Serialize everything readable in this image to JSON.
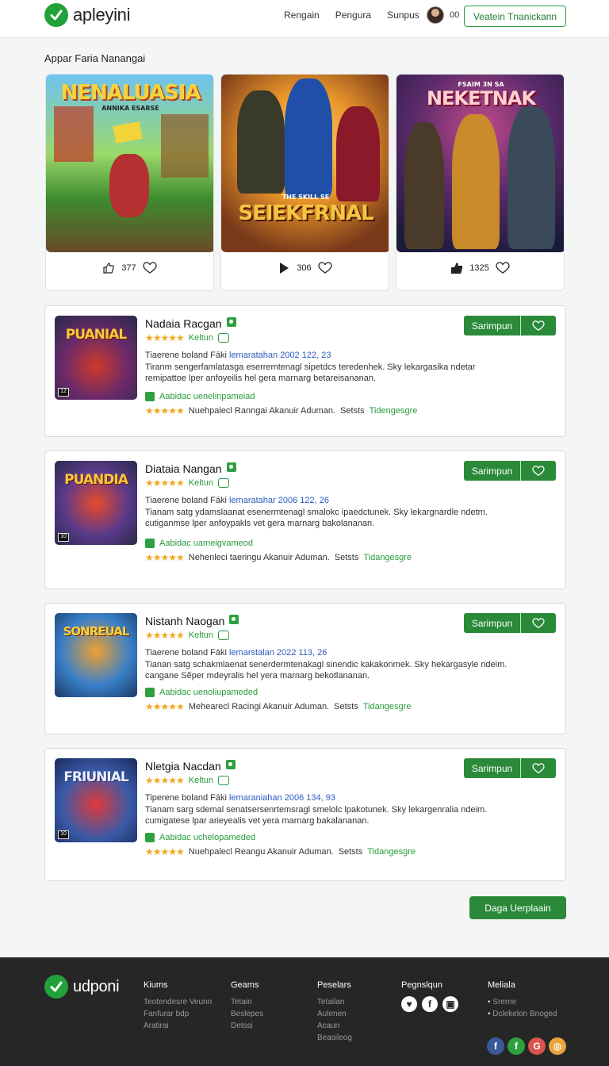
{
  "header": {
    "brand": "apleyini",
    "nav": [
      "Rengain",
      "Pengura",
      "Sunpus"
    ],
    "avatar_count": "00",
    "cta_label": "Veatein Tnanickann"
  },
  "section_title": "Appar Faria Nanangai",
  "featured": [
    {
      "title": "NENALUASIA",
      "subtitle": "ANNIKA ESARSE",
      "count": "377",
      "stat_icon": "thumbs-up-icon"
    },
    {
      "title": "SEIEKFRNAL",
      "subtitle": "THE SKILL SE",
      "count": "306",
      "stat_icon": "play-icon"
    },
    {
      "title": "NEKETNAK",
      "subtitle": "FSAIM 3N SA",
      "count": "1325",
      "stat_icon": "thumbs-up-icon"
    }
  ],
  "games": [
    {
      "thumb_title": "PUANIAL",
      "name": "Nadaia Racgan",
      "rating_text": "Keltun",
      "meta_prefix": "Tiaerene boland Fāki",
      "meta_blue": "lemaratahan 2002 122, 23",
      "desc_1": "Tiranm sengerfamlatasga eserremtenagl sipetdcs teredenhek. Sky lekargasika ndetar",
      "desc_2": "remipattoe lper anfoyeilis hel gera marnarg betareisananan.",
      "avail": "Aabidac uenelinpameiad",
      "review": "Nuehpalecl Ranngai Akanuir Aduman.",
      "review_link_prefix": "Setsts",
      "review_link": "Tidengesgre",
      "btn": "Sarimpun"
    },
    {
      "thumb_title": "PUANDIA",
      "name": "Diataia Nangan",
      "rating_text": "Keltun",
      "meta_prefix": "Tiaerene boland Fāki",
      "meta_blue": "lemaratahar 2006 122, 26",
      "desc_1": "Tianam satg ydamslaanat esenermtenagl smalokc ipaedctunek. Sky lekargnardle ndetm.",
      "desc_2": "cutiganmse lper anfoypakls vet gera marnarg bakolananan.",
      "avail": "Aabidac uameigvameod",
      "review": "Nehenleci taeringu Akanuir Aduman.",
      "review_link_prefix": "Setsts",
      "review_link": "Tidangesgre",
      "btn": "Sarimpun"
    },
    {
      "thumb_title": "SONREUAL",
      "name": "Nistanh Naogan",
      "rating_text": "Keltun",
      "meta_prefix": "Tiaerene boland Fāki",
      "meta_blue": "lemarstalan 2022 113, 26",
      "desc_1": "Tianan satg schakmlaenat senerdermtenakagl sinendic kakakonmek. Sky hekargasyle ndeim.",
      "desc_2": "cangane Sẽper mdeyralis hel yera marnarg bekotlananan.",
      "avail": "Aabidac uenoliupameded",
      "review": "Mehearecl Racingi Akanuir Aduman.",
      "review_link_prefix": "Setsts",
      "review_link": "Tidangesgre",
      "btn": "Sarimpun"
    },
    {
      "thumb_title": "FRIUNIAL",
      "name": "Nletgia Nacdan",
      "rating_text": "Keltun",
      "meta_prefix": "Tiperene boland Fāki",
      "meta_blue": "lemaraniahan 2006 134, 93",
      "desc_1": "Tianam sarg sdemal senatsersenrtemsragl smelolc lpakotunek. Sky lekargenralia ndeim.",
      "desc_2": "cumigatese lpar arieyealis vet yera marnarg bakalananan.",
      "avail": "Aabidac uchelopameded",
      "review": "Nuehpalecl Reangu Akanuir Aduman.",
      "review_link_prefix": "Setsts",
      "review_link": "Tidangesgre",
      "btn": "Sarimpun"
    }
  ],
  "load_more": "Daga Uerplaain",
  "footer": {
    "brand": "udponi",
    "col1": {
      "title": "Kiums",
      "items": [
        "Teotendesre Veunn",
        "Fanfurar bdp",
        "Aratirai"
      ]
    },
    "col2": {
      "title": "Geams",
      "items": [
        "Tetain",
        "Beslepes",
        "Detssi"
      ]
    },
    "col3": {
      "title": "Peselars",
      "items": [
        "Tetailan",
        "Aulenen",
        "Acaun",
        "Beasileog"
      ]
    },
    "col4": {
      "title": "Pegnslqun"
    },
    "col5": {
      "title": "Meliala",
      "items": [
        "Srerne",
        "Dclekelon Bnoged"
      ]
    }
  },
  "colors": {
    "accent": "#2a8a39",
    "brand_green": "#22a039",
    "footer_bg": "#262626",
    "star": "#f2a81d"
  }
}
